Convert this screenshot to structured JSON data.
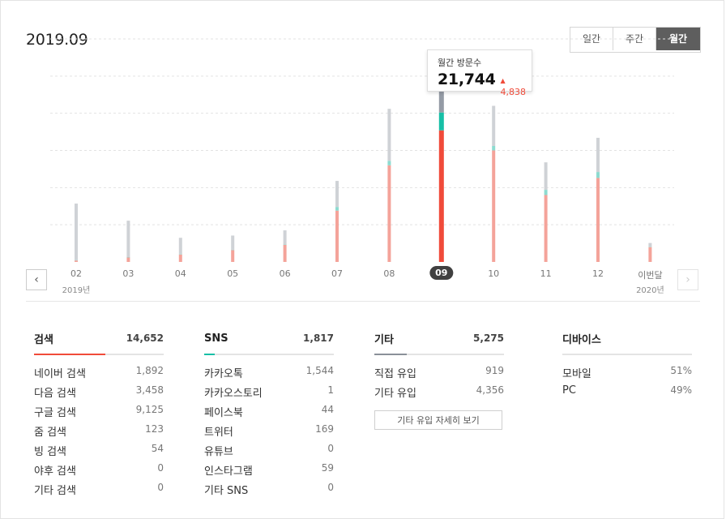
{
  "header": {
    "period": "2019.09",
    "tabs": [
      "일간",
      "주간",
      "월간"
    ],
    "active_tab": 2
  },
  "tooltip": {
    "label": "월간 방문수",
    "value": "21,744",
    "delta": "4,838",
    "delta_color": "#f04b3a"
  },
  "chart_data": {
    "type": "bar",
    "categories": [
      "02",
      "03",
      "04",
      "05",
      "06",
      "07",
      "08",
      "09",
      "10",
      "11",
      "12",
      "이번달"
    ],
    "year_labels": [
      {
        "index": 0,
        "text": "2019년"
      },
      {
        "index": 11,
        "text": "2020년"
      }
    ],
    "selected_index": 7,
    "series": [
      {
        "color": "#f4a39a",
        "color_selected": "#f04b3a",
        "values": [
          200,
          600,
          1000,
          1600,
          2300,
          6900,
          13000,
          17700,
          15000,
          9000,
          11300,
          2000
        ]
      },
      {
        "color": "#8ddbd0",
        "color_selected": "#17bfa6",
        "values": [
          50,
          50,
          50,
          50,
          50,
          500,
          600,
          2400,
          600,
          700,
          800,
          50
        ]
      },
      {
        "color": "#cfd2d6",
        "color_selected": "#949ba5",
        "values": [
          7600,
          4900,
          2200,
          1900,
          1900,
          3500,
          7000,
          6900,
          5400,
          3700,
          4600,
          500
        ]
      }
    ],
    "ylim": [
      0,
      30000
    ],
    "grid": true,
    "legend": "none"
  },
  "stats": [
    {
      "title": "검색",
      "total": "14,652",
      "accent": "#f04b3a",
      "fill_ratio": 0.55,
      "rows": [
        {
          "label": "네이버 검색",
          "value": "1,892"
        },
        {
          "label": "다음 검색",
          "value": "3,458"
        },
        {
          "label": "구글 검색",
          "value": "9,125"
        },
        {
          "label": "줌 검색",
          "value": "123"
        },
        {
          "label": "빙 검색",
          "value": "54"
        },
        {
          "label": "야후 검색",
          "value": "0"
        },
        {
          "label": "기타 검색",
          "value": "0"
        }
      ]
    },
    {
      "title": "SNS",
      "total": "1,817",
      "accent": "#17bfa6",
      "fill_ratio": 0.08,
      "rows": [
        {
          "label": "카카오톡",
          "value": "1,544"
        },
        {
          "label": "카카오스토리",
          "value": "1"
        },
        {
          "label": "페이스북",
          "value": "44"
        },
        {
          "label": "트위터",
          "value": "169"
        },
        {
          "label": "유튜브",
          "value": "0"
        },
        {
          "label": "인스타그램",
          "value": "59"
        },
        {
          "label": "기타 SNS",
          "value": "0"
        }
      ]
    },
    {
      "title": "기타",
      "total": "5,275",
      "accent": "#8a9099",
      "fill_ratio": 0.25,
      "rows": [
        {
          "label": "직접 유입",
          "value": "919"
        },
        {
          "label": "기타 유입",
          "value": "4,356"
        }
      ],
      "more_label": "기타 유입 자세히 보기"
    },
    {
      "title": "디바이스",
      "total": "",
      "accent": "#e4e4e4",
      "fill_ratio": 0,
      "rows": [
        {
          "label": "모바일",
          "value": "51%"
        },
        {
          "label": "PC",
          "value": "49%"
        }
      ]
    }
  ]
}
